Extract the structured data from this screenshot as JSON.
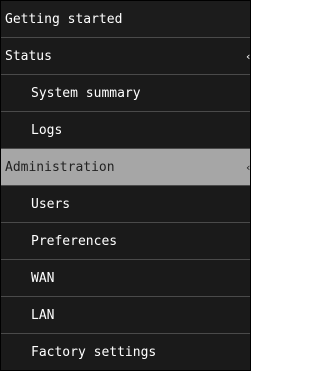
{
  "nav": {
    "items": [
      {
        "label": "Getting started"
      },
      {
        "label": "Status",
        "caret": "‹"
      },
      {
        "label": "System summary"
      },
      {
        "label": "Logs"
      },
      {
        "label": "Administration",
        "caret": "‹"
      },
      {
        "label": "Users"
      },
      {
        "label": "Preferences"
      },
      {
        "label": "WAN"
      },
      {
        "label": "LAN"
      },
      {
        "label": "Factory settings"
      }
    ]
  },
  "colors": {
    "menu_bg": "#1c1c1c",
    "active_bg": "#a6a6a6",
    "divider": "#4a4a4a",
    "text": "#ffffff"
  }
}
